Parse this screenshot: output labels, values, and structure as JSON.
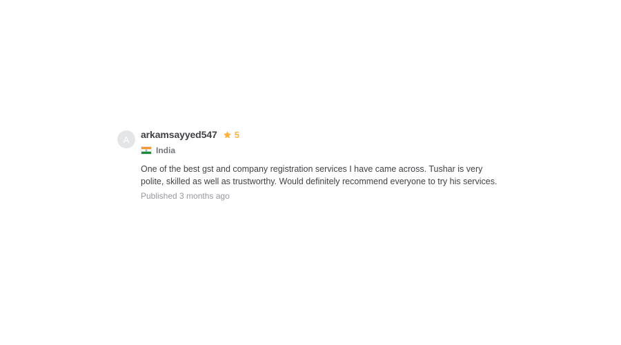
{
  "review": {
    "avatar_initial": "A",
    "username": "arkamsayyed547",
    "rating": "5",
    "country": "India",
    "description": "One of the best gst and company registration services I have came across. Tushar is very polite, skilled as well as trustworthy. Would definitely recommend everyone to try his services.",
    "published": "Published 3 months ago"
  },
  "icons": {
    "star": "star-icon",
    "flag": "india-flag-icon"
  },
  "colors": {
    "star": "#ffb33e",
    "username": "#404145",
    "muted": "#74767e",
    "published": "#95979d",
    "avatar_bg": "#e4e5e7"
  }
}
